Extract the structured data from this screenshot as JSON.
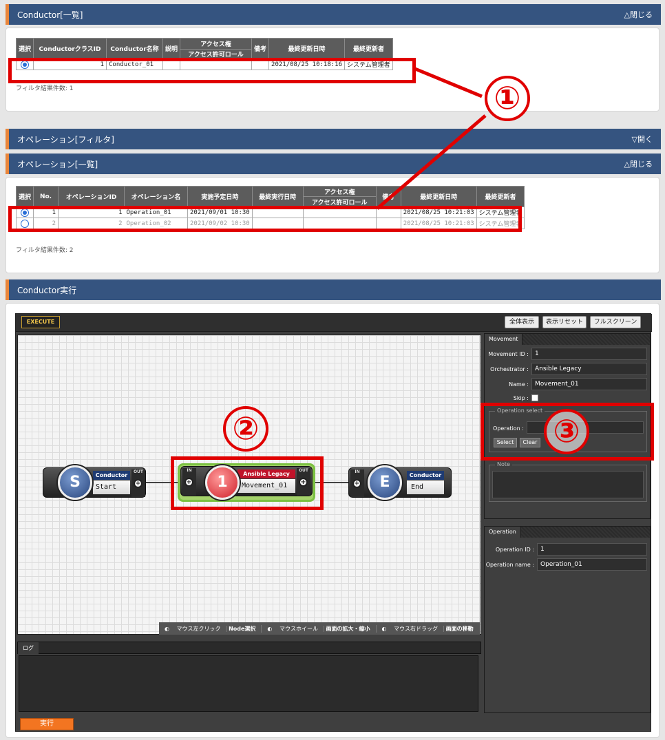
{
  "conductor_list": {
    "title": "Conductor[一覧]",
    "toggle": "△閉じる",
    "columns": [
      "選択",
      "ConductorクラスID",
      "Conductor名称",
      "説明",
      "アクセス権",
      "備考",
      "最終更新日時",
      "最終更新者"
    ],
    "access_sub": "アクセス許可ロール",
    "row": {
      "id": "1",
      "name": "Conductor_01",
      "updated": "2021/08/25 10:18:16",
      "user": "システム管理者"
    },
    "filter_count": "フィルタ結果件数: 1"
  },
  "operation_filter": {
    "title": "オペレーション[フィルタ]",
    "toggle": "▽開く"
  },
  "operation_list": {
    "title": "オペレーション[一覧]",
    "toggle": "△閉じる",
    "columns": [
      "選択",
      "No.",
      "オペレーションID",
      "オペレーション名",
      "実施予定日時",
      "最終実行日時",
      "アクセス権",
      "備考",
      "最終更新日時",
      "最終更新者"
    ],
    "access_sub": "アクセス許可ロール",
    "rows": [
      {
        "no": "1",
        "id": "1",
        "name": "Operation_01",
        "scheduled": "2021/09/01 10:30",
        "updated": "2021/08/25 10:21:03",
        "user": "システム管理者"
      },
      {
        "no": "2",
        "id": "2",
        "name": "Operation_02",
        "scheduled": "2021/09/02 10:30",
        "updated": "2021/08/25 10:21:03",
        "user": "システム管理者"
      }
    ],
    "filter_count": "フィルタ結果件数: 2"
  },
  "conductor_exec": {
    "title": "Conductor実行",
    "execute_label": "EXECUTE",
    "buttons": [
      "全体表示",
      "表示リセット",
      "フルスクリーン"
    ],
    "nodes": {
      "start": {
        "letter": "S",
        "header": "Conductor",
        "label": "Start",
        "port": "OUT"
      },
      "movement": {
        "letter": "1",
        "header": "Ansible Legacy",
        "label": "Movement_01",
        "port_in": "IN",
        "port_out": "OUT"
      },
      "end": {
        "letter": "E",
        "header": "Conductor",
        "label": "End",
        "port": "IN"
      }
    },
    "hints": [
      {
        "action": "マウス左クリック",
        "effect": "Node選択"
      },
      {
        "action": "マウスホイール",
        "effect": "画面の拡大・縮小"
      },
      {
        "action": "マウス右ドラッグ",
        "effect": "画面の移動"
      }
    ],
    "log_tab": "ログ",
    "run_label": "実行",
    "movement_panel": {
      "tab": "Movement",
      "fields": [
        {
          "label": "Movement ID :",
          "value": "1"
        },
        {
          "label": "Orchestrator :",
          "value": "Ansible Legacy"
        },
        {
          "label": "Name :",
          "value": "Movement_01"
        }
      ],
      "skip_label": "Skip :",
      "operation_select_legend": "Operation select",
      "operation_label": "Operation :",
      "select_btn": "Select",
      "clear_btn": "Clear",
      "note_legend": "Note"
    },
    "operation_panel": {
      "tab": "Operation",
      "fields": [
        {
          "label": "Operation ID :",
          "value": "1"
        },
        {
          "label": "Operation name :",
          "value": "Operation_01"
        }
      ]
    }
  },
  "callouts": [
    "①",
    "②",
    "③"
  ],
  "colors": {
    "header": "#355480",
    "accent": "#e9853a",
    "highlight": "#e00000",
    "run": "#f37521"
  }
}
